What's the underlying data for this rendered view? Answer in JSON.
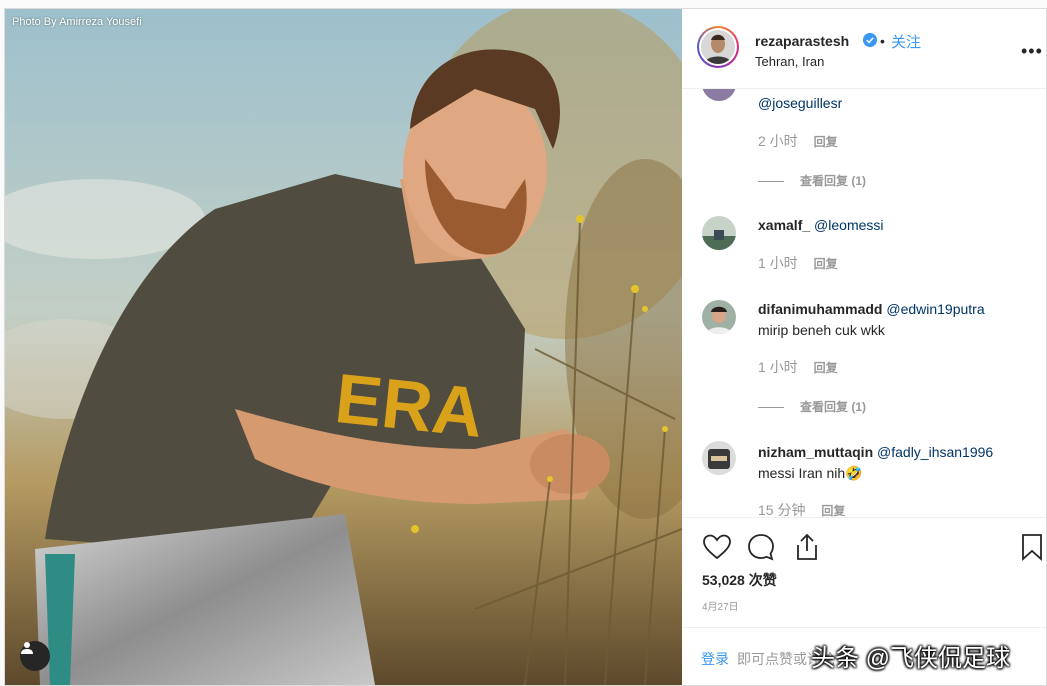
{
  "photo": {
    "credit": "Photo By Amirreza Yousefi",
    "shirt_text": "ERA"
  },
  "header": {
    "username": "rezaparastesh",
    "verified": true,
    "separator": "•",
    "follow_label": "关注",
    "location": "Tehran, Iran",
    "more": "•••"
  },
  "comments": [
    {
      "user": "",
      "mention": "@joseguillesr",
      "text": "",
      "time": "2 小时",
      "reply": "回复",
      "view_replies": "查看回复 (1)"
    },
    {
      "user": "xamalf_",
      "mention": "@leomessi",
      "text": "",
      "time": "1 小时",
      "reply": "回复",
      "view_replies": ""
    },
    {
      "user": "difanimuhammadd",
      "mention": "@edwin19putra",
      "text": "mirip beneh cuk wkk",
      "time": "1 小时",
      "reply": "回复",
      "view_replies": "查看回复 (1)"
    },
    {
      "user": "nizham_muttaqin",
      "mention": "@fadly_ihsan1996",
      "text": "messi Iran nih🤣",
      "time": "15 分钟",
      "reply": "回复",
      "view_replies": ""
    }
  ],
  "actions": {
    "likes": "53,028 次赞",
    "date": "4月27日"
  },
  "login": {
    "link": "登录",
    "text": "即可点赞或评论"
  },
  "watermark": "头条 @飞侠侃足球",
  "colors": {
    "link": "#3897f0",
    "mention": "#003569",
    "muted": "#999999"
  }
}
